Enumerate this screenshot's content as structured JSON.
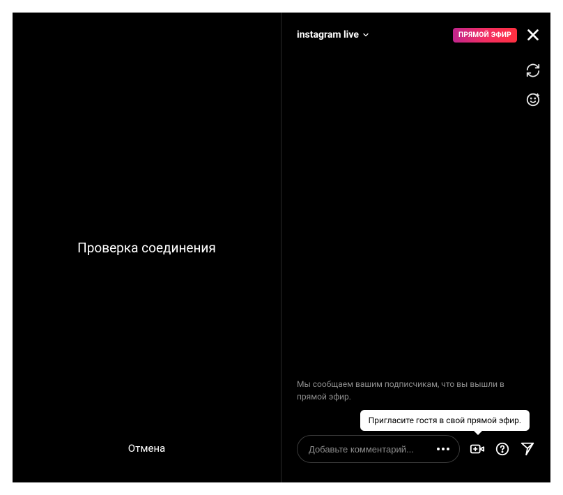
{
  "left": {
    "status_text": "Проверка соединения",
    "cancel_label": "Отмена"
  },
  "header": {
    "title": "instagram live",
    "live_badge": "ПРЯМОЙ ЭФИР"
  },
  "notice_text": "Мы сообщаем вашим подписчикам, что вы вышли в прямой эфир.",
  "tooltip_text": "Пригласите гостя в свой прямой эфир.",
  "comment": {
    "placeholder": "Добавьте комментарий..."
  },
  "icons": {
    "chevron": "chevron-down",
    "close": "close",
    "refresh": "camera-switch",
    "face": "face-filter",
    "more": "more",
    "invite": "add-camera",
    "question": "question",
    "send": "send"
  }
}
